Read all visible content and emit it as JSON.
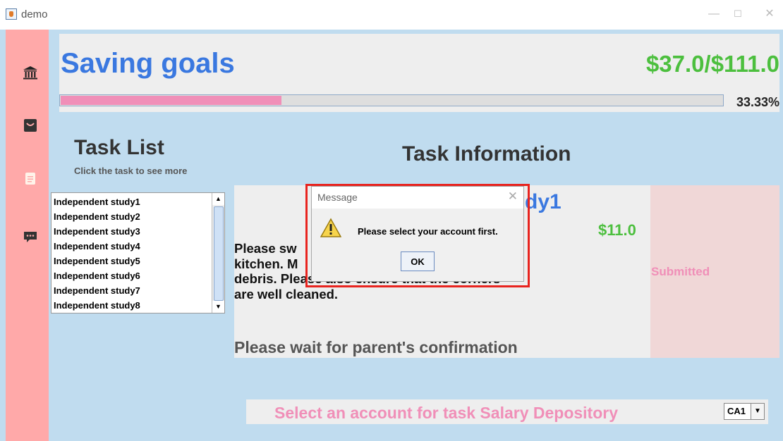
{
  "window": {
    "title": "demo",
    "minimize": "—",
    "maximize": "☐",
    "close": "✕"
  },
  "sidebar": {
    "icons": [
      "bank-icon",
      "shopping-bag-icon",
      "clipboard-icon",
      "chat-icon"
    ]
  },
  "header": {
    "title": "Saving goals",
    "amount": "$37.0/$111.0",
    "progress_fraction": 0.3333,
    "progress_label": "33.33%"
  },
  "task_list": {
    "title": "Task List",
    "subtitle": "Click the task to see more",
    "items": [
      "Independent study1",
      "Independent study2",
      "Independent study3",
      "Independent study4",
      "Independent study5",
      "Independent study6",
      "Independent study7",
      "Independent study8"
    ]
  },
  "task_info": {
    "title": "Task Information",
    "name_visible": "dy1",
    "amount": "$11.0",
    "status": "Submitted",
    "description_lines": [
      "Please sw                                    om and",
      "kitchen. M                                    and",
      "debris. Please also ensure that the corners",
      "are well cleaned."
    ],
    "wait_message": "Please wait for parent's confirmation"
  },
  "account_select": {
    "prompt": "Select an account for task Salary Depository",
    "selected": "CA1"
  },
  "dialog": {
    "title": "Message",
    "message": "Please select your account first.",
    "ok_label": "OK",
    "close": "✕"
  },
  "colors": {
    "sidebar": "#ffa9a9",
    "background": "#c0dcef",
    "title_blue": "#3a78e0",
    "money_green": "#4cbf3e",
    "pink": "#f08fb8",
    "highlight_red": "#e8231e"
  }
}
